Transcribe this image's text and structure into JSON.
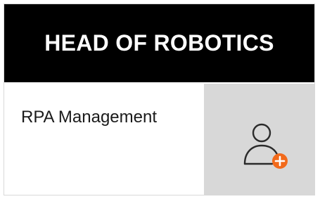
{
  "card": {
    "title": "HEAD OF ROBOTICS",
    "role_name": "RPA Management",
    "assign_icon": "user-add-icon",
    "header_color": "#000000",
    "slot_color": "#d8d8d8",
    "accent_color": "#f26a1b"
  }
}
